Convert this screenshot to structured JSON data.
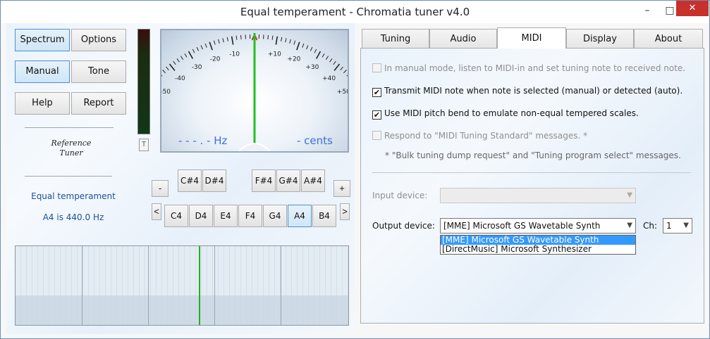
{
  "window": {
    "title": "Equal temperament - Chromatia tuner v4.0",
    "min": "–",
    "max": "□",
    "close": "✕"
  },
  "left": {
    "buttons": {
      "spectrum": "Spectrum",
      "options": "Options",
      "manual": "Manual",
      "tone": "Tone",
      "help": "Help",
      "report": "Report"
    },
    "logo_line1": "Reference",
    "logo_line2": "Tuner",
    "temperament": "Equal temperament",
    "reference": "A4 is 440.0 Hz",
    "level_knob": "T",
    "hz_readout": "- - - . -  Hz",
    "cents_readout": "-  cents",
    "meter_ticks": [
      "-50",
      "-40",
      "-30",
      "-20",
      "-10",
      "+10",
      "+20",
      "+30",
      "+40",
      "+50"
    ],
    "minus": "-",
    "plus": "+",
    "prev": "<",
    "next": ">",
    "sharps": [
      "C#4",
      "D#4",
      "F#4",
      "G#4",
      "A#4"
    ],
    "naturals": [
      "C4",
      "D4",
      "E4",
      "F4",
      "G4",
      "A4",
      "B4"
    ]
  },
  "tabs": [
    "Tuning",
    "Audio",
    "MIDI",
    "Display",
    "About"
  ],
  "midi": {
    "opt1": "In manual mode, listen to MIDI-in and set tuning note to received note.",
    "opt2": "Transmit MIDI note when note is selected (manual) or detected (auto).",
    "opt3": "Use MIDI pitch bend to emulate non-equal tempered scales.",
    "opt4": "Respond to \"MIDI Tuning Standard\" messages. *",
    "note": "*  \"Bulk tuning dump request\"  and  \"Tuning program select\"  messages.",
    "check": "✔",
    "input_label": "Input device:",
    "input_value": "",
    "output_label": "Output device:",
    "output_value": "[MME] Microsoft GS Wavetable Synth",
    "ch_label": "Ch:",
    "ch_value": "1",
    "arrow": "▼",
    "dropdown": [
      "[MME] Microsoft GS Wavetable Synth",
      "[DirectMusic] Microsoft Synthesizer"
    ]
  }
}
